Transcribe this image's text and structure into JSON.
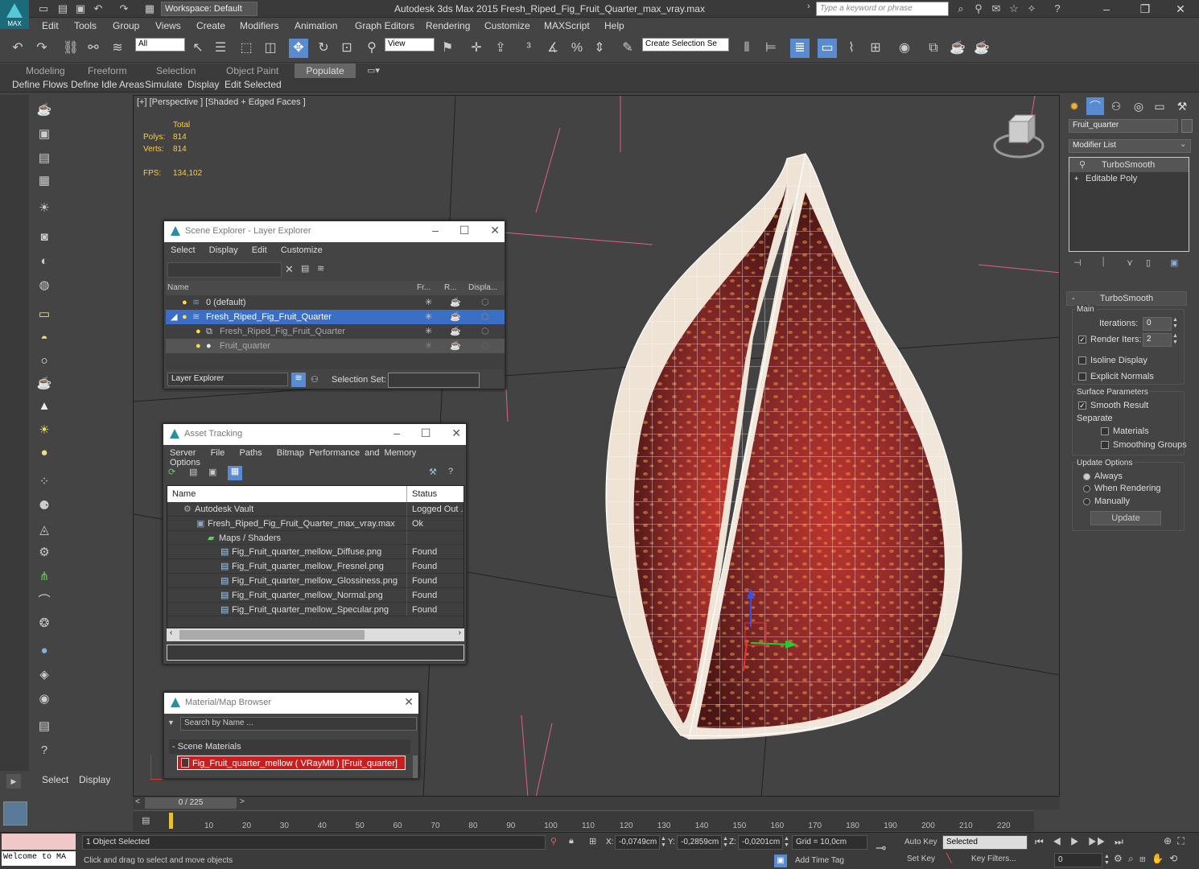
{
  "title_bar": {
    "workspace": "Workspace: Default",
    "app_title": "Autodesk 3ds Max  2015    Fresh_Riped_Fig_Fruit_Quarter_max_vray.max",
    "search_placeholder": "Type a keyword or phrase",
    "logo_text": "MAX"
  },
  "menu": [
    "Edit",
    "Tools",
    "Group",
    "Views",
    "Create",
    "Modifiers",
    "Animation",
    "Graph Editors",
    "Rendering",
    "Customize",
    "MAXScript",
    "Help"
  ],
  "toolbar": {
    "filter": "All",
    "ref_coord": "View",
    "selection_set": "Create Selection Se"
  },
  "ribbon": {
    "tabs": [
      "Modeling",
      "Freeform",
      "Selection",
      "Object Paint",
      "Populate"
    ],
    "active_tab": "Populate",
    "buttons": [
      "Define Flows",
      "Define Idle Areas",
      "Simulate",
      "Display",
      "Edit Selected"
    ]
  },
  "viewport": {
    "label": "[+] [Perspective ] [Shaded + Edged Faces ]",
    "stats": {
      "total": "Total",
      "polys_label": "Polys:",
      "polys": "814",
      "verts_label": "Verts:",
      "verts": "814",
      "fps_label": "FPS:",
      "fps": "134,102"
    }
  },
  "scene_explorer": {
    "title": "Scene Explorer - Layer Explorer",
    "menu": [
      "Select",
      "Display",
      "Edit",
      "Customize"
    ],
    "columns": [
      "Name",
      "Fr...",
      "R...",
      "Displa..."
    ],
    "rows": [
      {
        "name": "0 (default)"
      },
      {
        "name": "Fresh_Riped_Fig_Fruit_Quarter"
      },
      {
        "name": "Fresh_Riped_Fig_Fruit_Quarter"
      },
      {
        "name": "Fruit_quarter"
      }
    ],
    "footer_mode": "Layer Explorer",
    "selection_set_label": "Selection Set:"
  },
  "asset_tracking": {
    "title": "Asset Tracking",
    "menu": [
      "Server",
      "File",
      "Paths",
      "Bitmap Performance and Memory",
      "Options"
    ],
    "columns": [
      "Name",
      "Status"
    ],
    "rows": [
      {
        "name": "Autodesk Vault",
        "status": "Logged Out ..."
      },
      {
        "name": "Fresh_Riped_Fig_Fruit_Quarter_max_vray.max",
        "status": "Ok"
      },
      {
        "name": "Maps / Shaders",
        "status": ""
      },
      {
        "name": "Fig_Fruit_quarter_mellow_Diffuse.png",
        "status": "Found"
      },
      {
        "name": "Fig_Fruit_quarter_mellow_Fresnel.png",
        "status": "Found"
      },
      {
        "name": "Fig_Fruit_quarter_mellow_Glossiness.png",
        "status": "Found"
      },
      {
        "name": "Fig_Fruit_quarter_mellow_Normal.png",
        "status": "Found"
      },
      {
        "name": "Fig_Fruit_quarter_mellow_Specular.png",
        "status": "Found"
      }
    ]
  },
  "material_browser": {
    "title": "Material/Map Browser",
    "search_placeholder": "Search by Name ...",
    "section": "- Scene Materials",
    "material": "Fig_Fruit_quarter_mellow  ( VRayMtl )  [Fruit_quarter]"
  },
  "command_panel": {
    "object_name": "Fruit_quarter",
    "modifier_list": "Modifier List",
    "stack": [
      "TurboSmooth",
      "Editable Poly"
    ],
    "rollout_title": "TurboSmooth",
    "main_label": "Main",
    "iterations_label": "Iterations:",
    "iterations": "0",
    "render_iters_label": "Render Iters:",
    "render_iters": "2",
    "isoline": "Isoline Display",
    "explicit_normals": "Explicit Normals",
    "surface_params": "Surface Parameters",
    "smooth_result": "Smooth Result",
    "separate": "Separate",
    "materials": "Materials",
    "smoothing_groups": "Smoothing Groups",
    "update_options": "Update Options",
    "always": "Always",
    "when_rendering": "When Rendering",
    "manually": "Manually",
    "update_btn": "Update"
  },
  "left_panel": {
    "select": "Select",
    "display": "Display"
  },
  "timeline": {
    "frame": "0 / 225",
    "ticks": [
      "10",
      "20",
      "30",
      "40",
      "50",
      "60",
      "70",
      "80",
      "90",
      "100",
      "110",
      "120",
      "130",
      "140",
      "150",
      "160",
      "170",
      "180",
      "190",
      "200",
      "210",
      "220"
    ]
  },
  "status": {
    "welcome": "Welcome to MA",
    "selected": "1 Object Selected",
    "prompt": "Click and drag to select and move objects",
    "x_label": "X:",
    "x": "-0,0749cm",
    "y_label": "Y:",
    "y": "-0,2859cm",
    "z_label": "Z:",
    "z": "-0,0201cm",
    "grid": "Grid = 10,0cm",
    "add_time_tag": "Add Time Tag",
    "auto_key": "Auto Key",
    "selected_dd": "Selected",
    "set_key": "Set Key",
    "key_filters": "Key Filters...",
    "frame_field": "0"
  }
}
